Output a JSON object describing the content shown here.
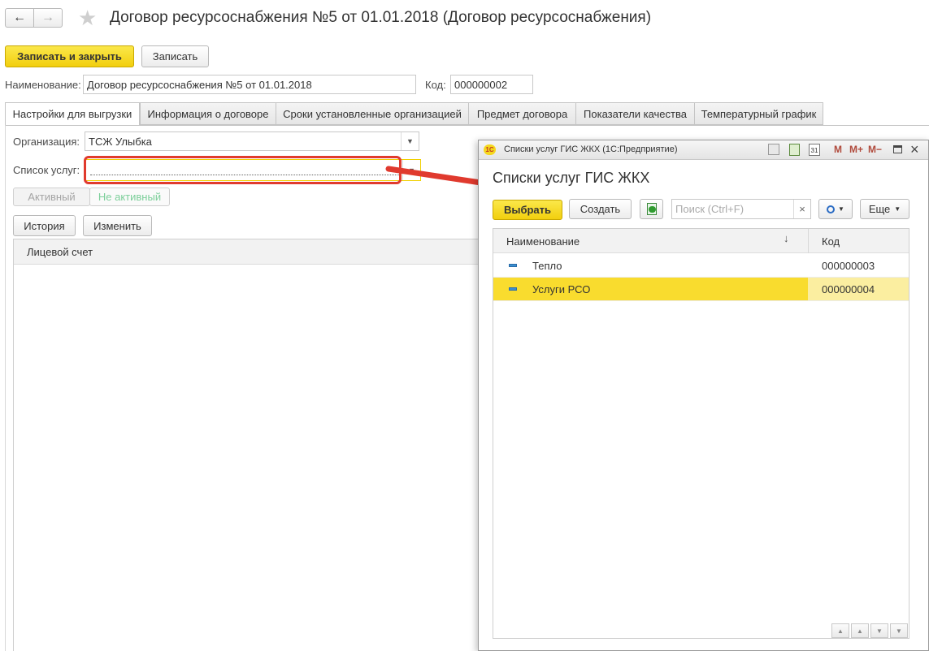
{
  "window": {
    "title": "Договор ресурсоснабжения №5 от 01.01.2018 (Договор ресурсоснабжения)"
  },
  "toolbar": {
    "save_close_label": "Записать и закрыть",
    "save_label": "Записать"
  },
  "form": {
    "name_label": "Наименование:",
    "name_value": "Договор ресурсоснабжения №5 от 01.01.2018",
    "code_label": "Код:",
    "code_value": "000000002"
  },
  "tabs": [
    {
      "label": "Настройки для выгрузки",
      "active": true
    },
    {
      "label": "Информация о договоре"
    },
    {
      "label": "Сроки установленные организацией"
    },
    {
      "label": "Предмет договора"
    },
    {
      "label": "Показатели качества"
    },
    {
      "label": "Температурный график"
    }
  ],
  "settings": {
    "org_label": "Организация:",
    "org_value": "ТСЖ Улыбка",
    "services_label": "Список услуг:",
    "services_value": "",
    "active_label": "Активный",
    "inactive_label": "Не активный",
    "history_label": "История",
    "edit_label": "Изменить",
    "table_header": "Лицевой счет"
  },
  "dialog": {
    "window_title": "Списки услуг ГИС ЖКХ  (1С:Предприятие)",
    "heading": "Списки услуг ГИС ЖКХ",
    "select_label": "Выбрать",
    "create_label": "Создать",
    "search_placeholder": "Поиск (Ctrl+F)",
    "more_label": "Еще",
    "columns": {
      "name": "Наименование",
      "code": "Код"
    },
    "rows": [
      {
        "name": "Тепло",
        "code": "000000003",
        "selected": false
      },
      {
        "name": "Услуги РСО",
        "code": "000000004",
        "selected": true
      }
    ],
    "titlebar_icons": {
      "m": "M",
      "mplus": "M+",
      "mminus": "M−"
    }
  },
  "colors": {
    "accent_yellow": "#f5d71c",
    "selection_row": "#f9dc2e",
    "highlight_red": "#e03a2e"
  }
}
